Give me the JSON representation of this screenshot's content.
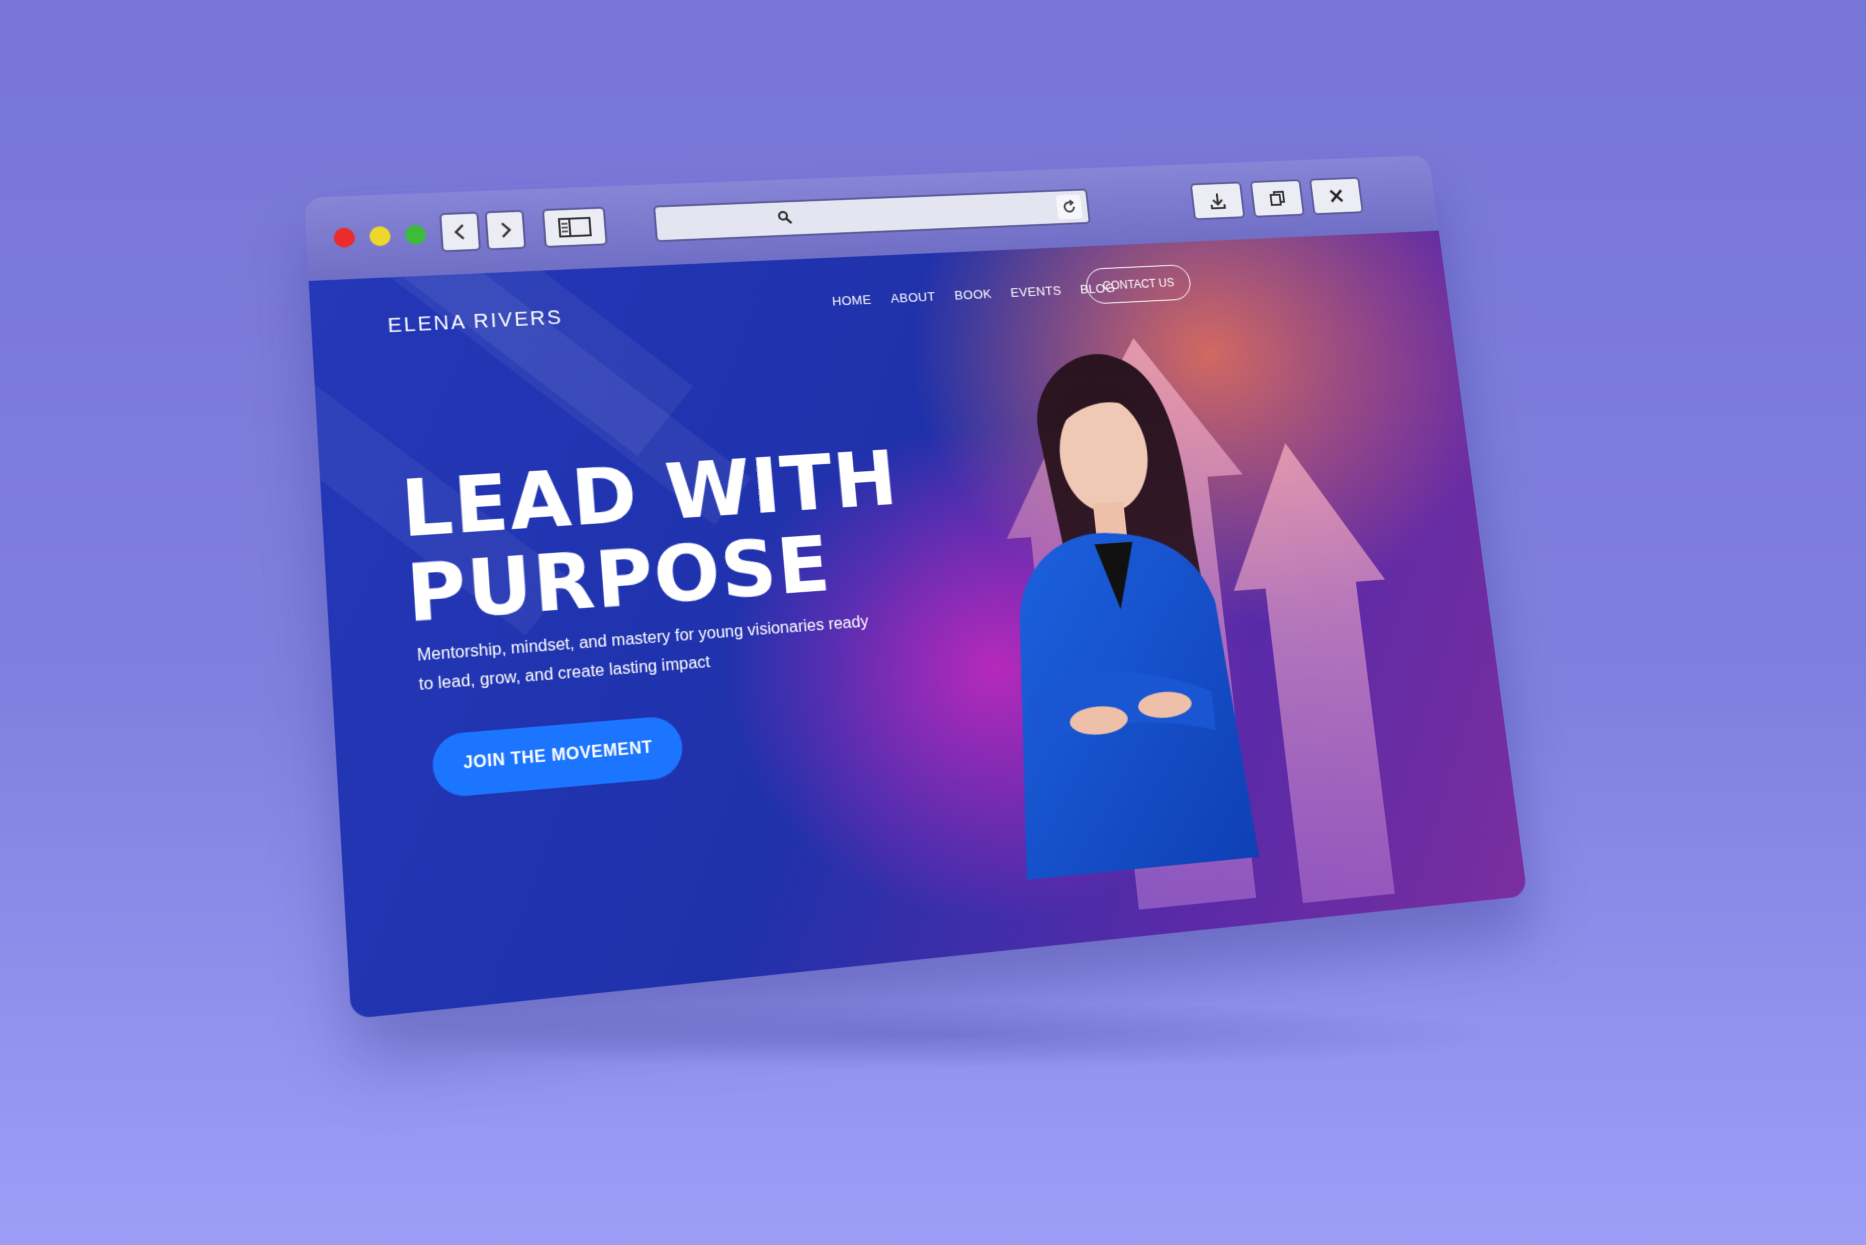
{
  "browser": {
    "controls": {
      "close_dot": "close-window",
      "minimize_dot": "minimize-window",
      "maximize_dot": "maximize-window"
    },
    "icons": [
      "chevron-left-icon",
      "chevron-right-icon",
      "sidebar-icon",
      "search-icon",
      "reload-icon",
      "download-icon",
      "copy-icon",
      "close-icon"
    ]
  },
  "site": {
    "brand": "ELENA RIVERS",
    "nav": [
      "HOME",
      "ABOUT",
      "BOOK",
      "EVENTS",
      "BLOG"
    ],
    "contact": "CONTACT US",
    "headline_line1": "LEAD WITH",
    "headline_line2": "PURPOSE",
    "subtitle": "Mentorship, mindset, and mastery for young visionaries ready to lead, grow, and create lasting impact",
    "cta": "JOIN THE MOVEMENT"
  },
  "colors": {
    "background": "#7a7ad8",
    "accent_button": "#1c75ff",
    "hero_blue": "#2438b8",
    "hero_magenta": "#cd28be",
    "hero_orange": "#eb7355"
  }
}
